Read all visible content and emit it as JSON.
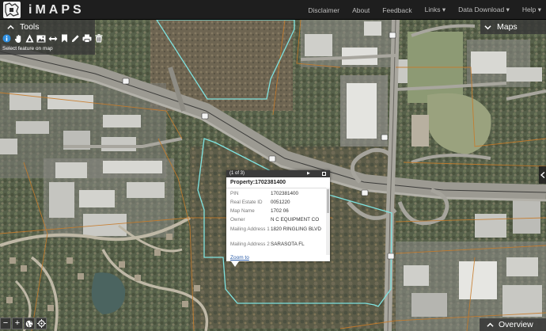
{
  "navbar": {
    "brand": "iMAPS",
    "items": [
      "Disclaimer",
      "About",
      "Feedback",
      "Links ▾",
      "Data Download ▾",
      "Help ▾"
    ]
  },
  "tools": {
    "title": "Tools",
    "hint": "Select feature on map",
    "icons": [
      "identify-icon",
      "pan-icon",
      "measure-icon",
      "image-icon",
      "resize-icon",
      "bookmark-icon",
      "draw-icon",
      "print-icon",
      "trash-icon"
    ]
  },
  "maps_panel": {
    "title": "Maps"
  },
  "overview": {
    "title": "Overview"
  },
  "popup": {
    "count": "(1 of 3)",
    "next": "▶",
    "title": "Property:1702381400",
    "rows": [
      {
        "key": "PIN",
        "value": "1702381400"
      },
      {
        "key": "Real Estate ID",
        "value": "0051220"
      },
      {
        "key": "Map Name",
        "value": "1702 06"
      },
      {
        "key": "Owner",
        "value": "N C EQUIPMENT CO"
      },
      {
        "key": "Mailing Address 1",
        "value": "1820 RINGLING BLVD"
      },
      {
        "key": "Mailing Address 2",
        "value": "SARASOTA FL"
      }
    ],
    "zoom_link": "Zoom to"
  },
  "zoom_controls": [
    "−",
    "+",
    "●",
    "◎"
  ],
  "colors": {
    "parcel_outline": "#7fe3e0",
    "navbar_bg": "#1e1e1e",
    "panel_bg": "#373737",
    "link": "#2a5ca8"
  }
}
